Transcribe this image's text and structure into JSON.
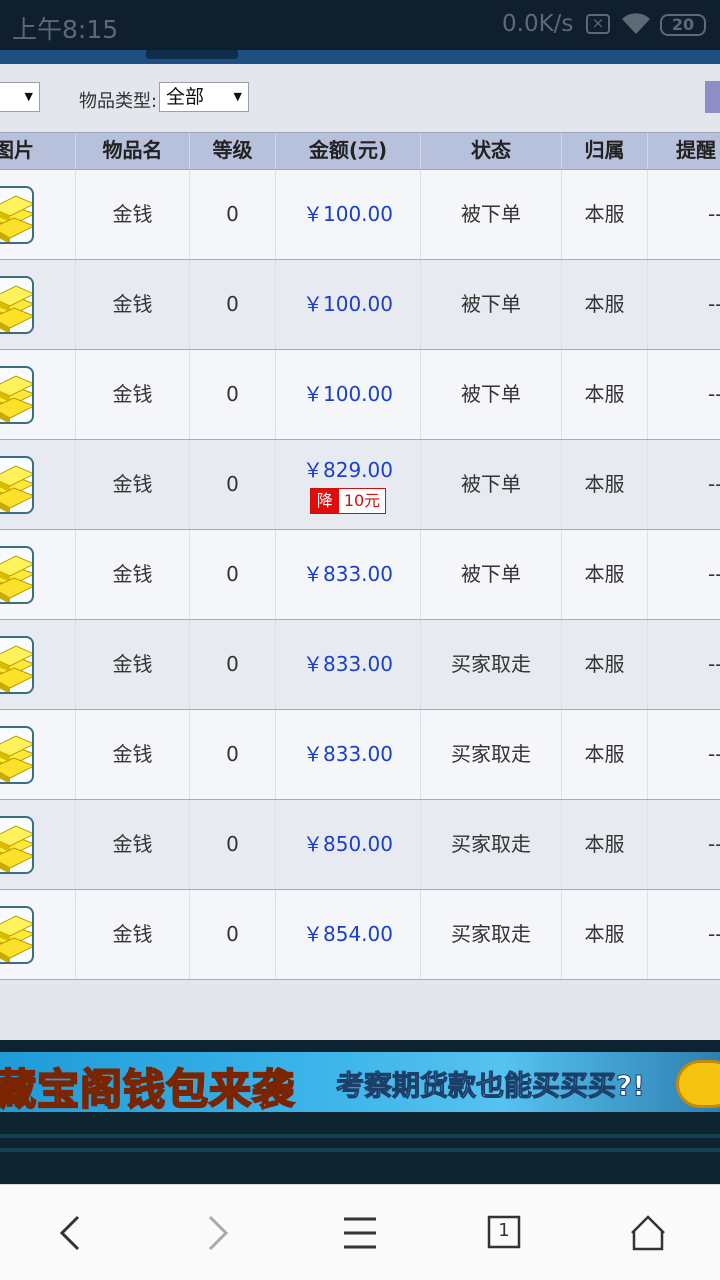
{
  "status_bar": {
    "time": "上午8:15",
    "net_speed": "0.0K/s",
    "battery": "20"
  },
  "filters": {
    "item_type_label": "物品类型:",
    "item_type_value": "全部"
  },
  "table": {
    "columns": [
      "图片",
      "物品名",
      "等级",
      "金额(元)",
      "状态",
      "归属",
      "提醒"
    ],
    "rows": [
      {
        "name": "金钱",
        "level": "0",
        "price": "￥100.00",
        "status": "被下单",
        "owner": "本服",
        "remind": "--"
      },
      {
        "name": "金钱",
        "level": "0",
        "price": "￥100.00",
        "status": "被下单",
        "owner": "本服",
        "remind": "--"
      },
      {
        "name": "金钱",
        "level": "0",
        "price": "￥100.00",
        "status": "被下单",
        "owner": "本服",
        "remind": "--"
      },
      {
        "name": "金钱",
        "level": "0",
        "price": "￥829.00",
        "status": "被下单",
        "owner": "本服",
        "remind": "--",
        "drop_tag": "降",
        "drop_amount": "10元"
      },
      {
        "name": "金钱",
        "level": "0",
        "price": "￥833.00",
        "status": "被下单",
        "owner": "本服",
        "remind": "--"
      },
      {
        "name": "金钱",
        "level": "0",
        "price": "￥833.00",
        "status": "买家取走",
        "owner": "本服",
        "remind": "--"
      },
      {
        "name": "金钱",
        "level": "0",
        "price": "￥833.00",
        "status": "买家取走",
        "owner": "本服",
        "remind": "--"
      },
      {
        "name": "金钱",
        "level": "0",
        "price": "￥850.00",
        "status": "买家取走",
        "owner": "本服",
        "remind": "--"
      },
      {
        "name": "金钱",
        "level": "0",
        "price": "￥854.00",
        "status": "买家取走",
        "owner": "本服",
        "remind": "--"
      }
    ]
  },
  "banner": {
    "title": "藏宝阁钱包来袭",
    "subtitle": "考察期货款也能买买买?!"
  },
  "bottom_nav": {
    "tab_count": "1",
    "icons": [
      "back-icon",
      "forward-icon",
      "menu-icon",
      "tabs-icon",
      "home-icon"
    ]
  },
  "colors": {
    "header_bg": "#b8c1dc",
    "price_blue": "#1a3fc9",
    "drop_red": "#e10c0c",
    "status_bar_bg": "#0f1f2e",
    "nav_blue": "#1d4f80"
  }
}
